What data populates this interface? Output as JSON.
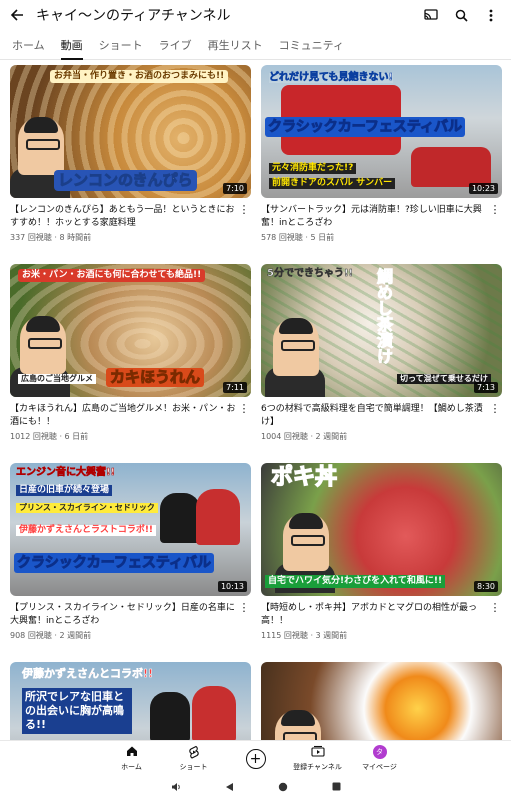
{
  "header": {
    "title": "キャイ〜ンのティアチャンネル",
    "back_icon": "arrow-left-icon",
    "icons": [
      "cast-icon",
      "search-icon",
      "more-vert-icon"
    ]
  },
  "tabs": [
    {
      "label": "ホーム",
      "active": false
    },
    {
      "label": "動画",
      "active": true
    },
    {
      "label": "ショート",
      "active": false
    },
    {
      "label": "ライブ",
      "active": false
    },
    {
      "label": "再生リスト",
      "active": false
    },
    {
      "label": "コミュニティ",
      "active": false
    }
  ],
  "videos": [
    {
      "title": "【レンコンのきんぴら】あともう一品！というときにおすすめ！！ホッとする家庭料理",
      "views": "337 回視聴",
      "age": "8 時間前",
      "duration": "7:10",
      "thumb_text_top": "お弁当・作り置き・お酒のおつまみにも!!",
      "thumb_text_main": "レンコンのきんぴら"
    },
    {
      "title": "【サンバートラック】元は消防車！?珍しい旧車に大興奮！inところざわ",
      "views": "578 回視聴",
      "age": "5 日前",
      "duration": "10:23",
      "thumb_text_top": "どれだけ見ても見飽きない!",
      "thumb_text_main": "クラシックカーフェスティバル",
      "thumb_text_sub1": "元々消防車だった!?",
      "thumb_text_sub2": "前開きドアのスバル サンバー"
    },
    {
      "title": "【カキほうれん】広島のご当地グルメ！お米・パン・お酒にも！！",
      "views": "1012 回視聴",
      "age": "6 日前",
      "duration": "7:11",
      "thumb_text_top": "お米・パン・お酒にも何に合わせても絶品!!",
      "thumb_text_main": "カキほうれん",
      "thumb_text_sub1": "広島のご当地グルメ"
    },
    {
      "title": "6つの材料で高級料理を自宅で簡単調理！【鯛めし茶漬け】",
      "views": "1004 回視聴",
      "age": "2 週間前",
      "duration": "7:13",
      "thumb_text_top": "5分でできちゃう!!",
      "thumb_text_main": "鯛めし茶漬け",
      "thumb_text_sub1": "切って混ぜて乗せるだけ"
    },
    {
      "title": "【プリンス・スカイライン・セドリック】日産の名車に大興奮！inところざわ",
      "views": "908 回視聴",
      "age": "2 週間前",
      "duration": "10:13",
      "thumb_text_top": "エンジン音に大興奮!!",
      "thumb_text_main": "クラシックカーフェスティバル",
      "thumb_text_sub1": "日産の旧車が続々登場",
      "thumb_text_sub2": "プリンス・スカイライン・セドリック",
      "thumb_text_sub3": "伊藤かずえさんとラストコラボ!!"
    },
    {
      "title": "【時短めし・ポキ丼】アボカドとマグロの相性が最っ高！！",
      "views": "1115 回視聴",
      "age": "3 週間前",
      "duration": "8:30",
      "thumb_text_top": "ポキ丼",
      "thumb_text_main": "自宅でハワイ気分!わさびを入れて和風に!!"
    },
    {
      "title": "",
      "views": "",
      "age": "",
      "duration": "",
      "thumb_text_top": "伊藤かずえさんとコラボ!!",
      "thumb_text_main": "所沢でレアな旧車との出会いに胸が高鳴る!!"
    },
    {
      "title": "",
      "views": "",
      "age": "",
      "duration": "",
      "thumb_text_top": "",
      "thumb_text_main": ""
    }
  ],
  "bottom_nav": [
    {
      "label": "ホーム",
      "icon": "home-icon"
    },
    {
      "label": "ショート",
      "icon": "shorts-icon"
    },
    {
      "label": "",
      "icon": "create-plus-icon"
    },
    {
      "label": "登録チャンネル",
      "icon": "subscriptions-icon"
    },
    {
      "label": "マイページ",
      "icon": "avatar-icon",
      "avatar_letter": "タ"
    }
  ],
  "system_nav": [
    "volume-icon",
    "back-triangle-icon",
    "home-circle-icon",
    "recents-square-icon"
  ],
  "colors": {
    "accent": "#0f0f0f",
    "secondary_text": "#606060",
    "avatar": "#b13ccf"
  }
}
